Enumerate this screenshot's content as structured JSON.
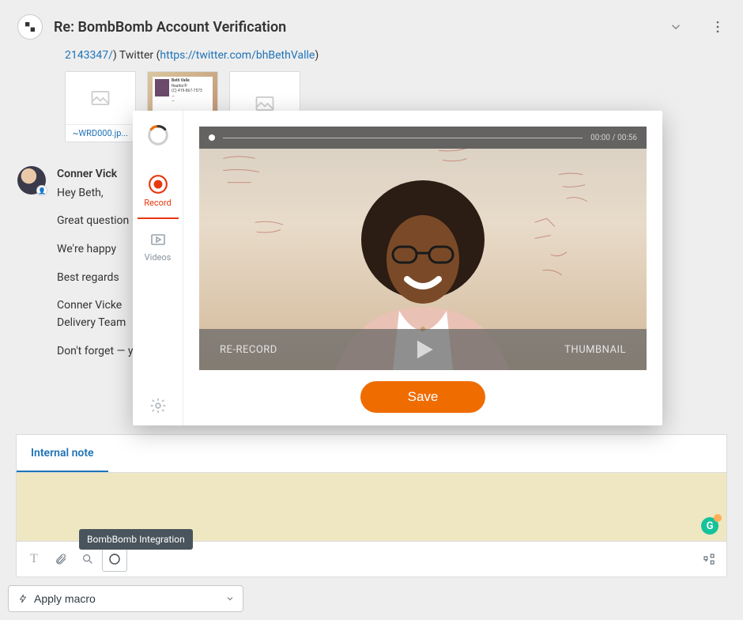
{
  "header": {
    "title": "Re: BombBomb Account Verification"
  },
  "snippet": {
    "pre_num": "2143347/",
    "mid_text": ") Twitter (",
    "url": "https://twitter.com/bhBethValle",
    "post": ")"
  },
  "attachments": [
    {
      "label": "~WRD000.jp..."
    },
    {
      "label": ""
    },
    {
      "label": ""
    }
  ],
  "message": {
    "author": "Conner Vick",
    "lines": {
      "greeting": "Hey Beth,",
      "p1": "Great question — happy to walk you through verification. You can also call into our Care team at",
      "p2": "We're happy",
      "p3": "Best regards",
      "p4a": "Conner Vicke",
      "p4b": "Delivery Team",
      "p5": "Don't forget — you can always start a live chat with one of our Care agents."
    }
  },
  "compose": {
    "tab_internal": "Internal note",
    "tooltip": "BombBomb Integration"
  },
  "footer": {
    "apply_macro": "Apply macro"
  },
  "modal": {
    "sidebar": {
      "record": "Record",
      "videos": "Videos"
    },
    "video": {
      "time": "00:00 / 00:56",
      "rerecord": "RE-RECORD",
      "thumbnail": "THUMBNAIL"
    },
    "save": "Save"
  }
}
